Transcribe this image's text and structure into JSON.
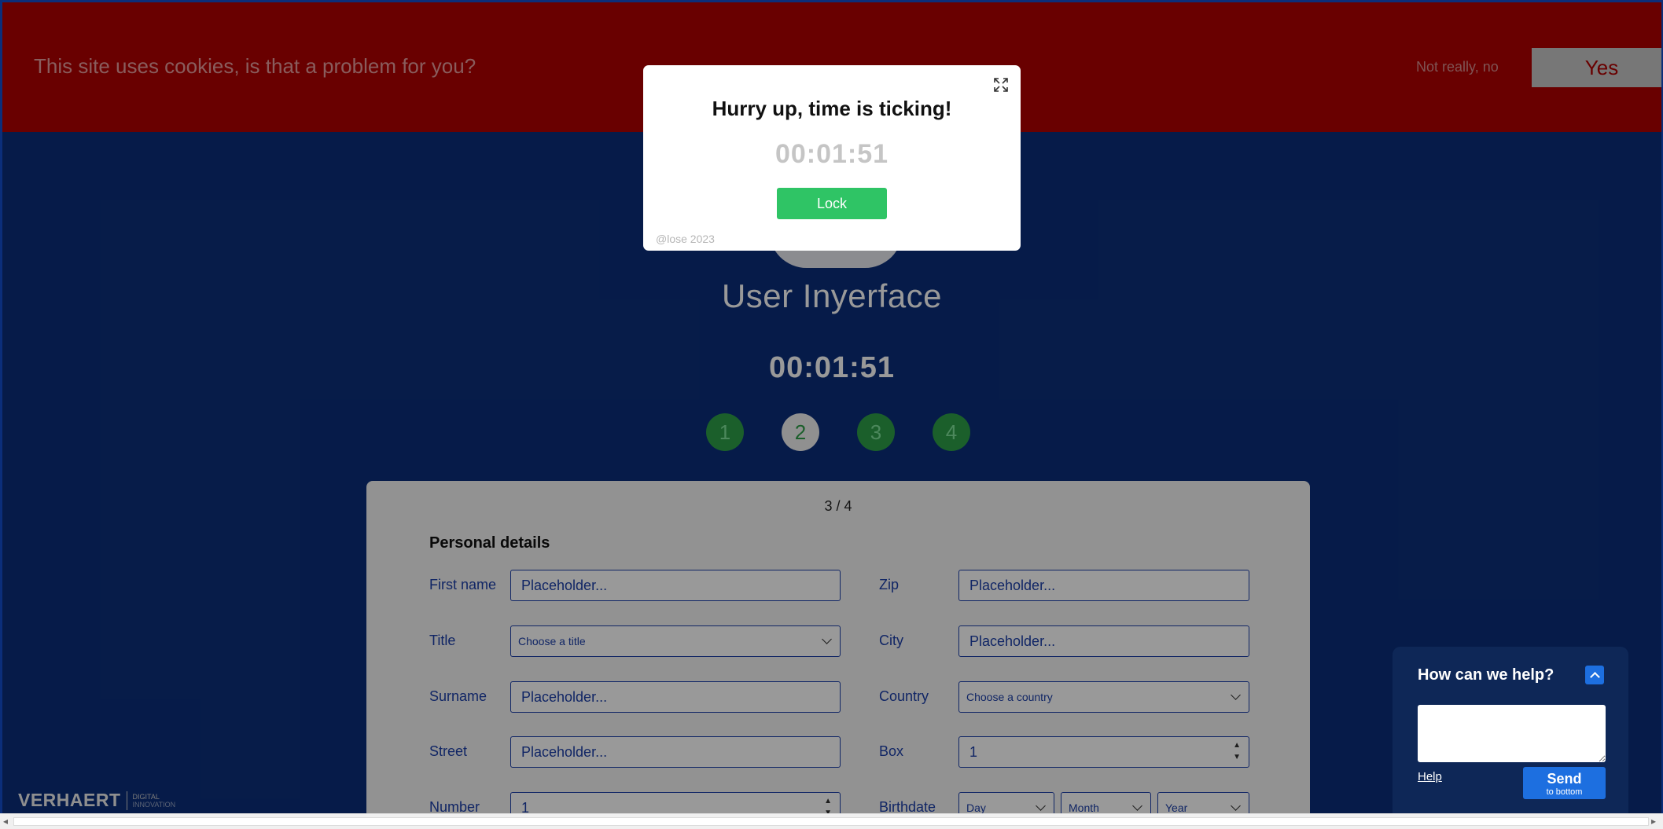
{
  "cookie": {
    "message": "This site uses cookies, is that a problem for you?",
    "decline_label": "Not really, no",
    "accept_label": "Yes"
  },
  "brand": {
    "title": "User Inyerface"
  },
  "timer": {
    "value": "00:01:51"
  },
  "steps": [
    "1",
    "2",
    "3",
    "4"
  ],
  "form": {
    "page_count": "3 / 4",
    "heading": "Personal details",
    "fields": {
      "first_name": {
        "label": "First name",
        "placeholder": "Placeholder..."
      },
      "title": {
        "label": "Title",
        "value": "Choose a title"
      },
      "surname": {
        "label": "Surname",
        "placeholder": "Placeholder..."
      },
      "street": {
        "label": "Street",
        "placeholder": "Placeholder..."
      },
      "number": {
        "label": "Number",
        "value": "1"
      },
      "zip": {
        "label": "Zip",
        "placeholder": "Placeholder..."
      },
      "city": {
        "label": "City",
        "placeholder": "Placeholder..."
      },
      "country": {
        "label": "Country",
        "value": "Choose a country"
      },
      "box": {
        "label": "Box",
        "value": "1"
      },
      "birthdate": {
        "label": "Birthdate",
        "day": "Day",
        "month": "Month",
        "year": "Year"
      }
    }
  },
  "modal": {
    "title": "Hurry up, time is ticking!",
    "timer": "00:01:51",
    "lock_label": "Lock",
    "copyright": "@lose 2023",
    "expand_icon": "expand-icon"
  },
  "help": {
    "title": "How can we help?",
    "link_label": "Help",
    "send_label": "Send",
    "send_sublabel": "to bottom"
  },
  "footer_logo": {
    "name": "VERHAERT",
    "line1": "DIGITAL",
    "line2": "INNOVATION"
  },
  "colors": {
    "page_bg": "#0b2e7a",
    "cookie_bg": "#b00000",
    "step_green": "#2e9e48",
    "lock_green": "#2fc465",
    "help_bg": "#0e2757",
    "accent_blue": "#1d6fe0"
  }
}
